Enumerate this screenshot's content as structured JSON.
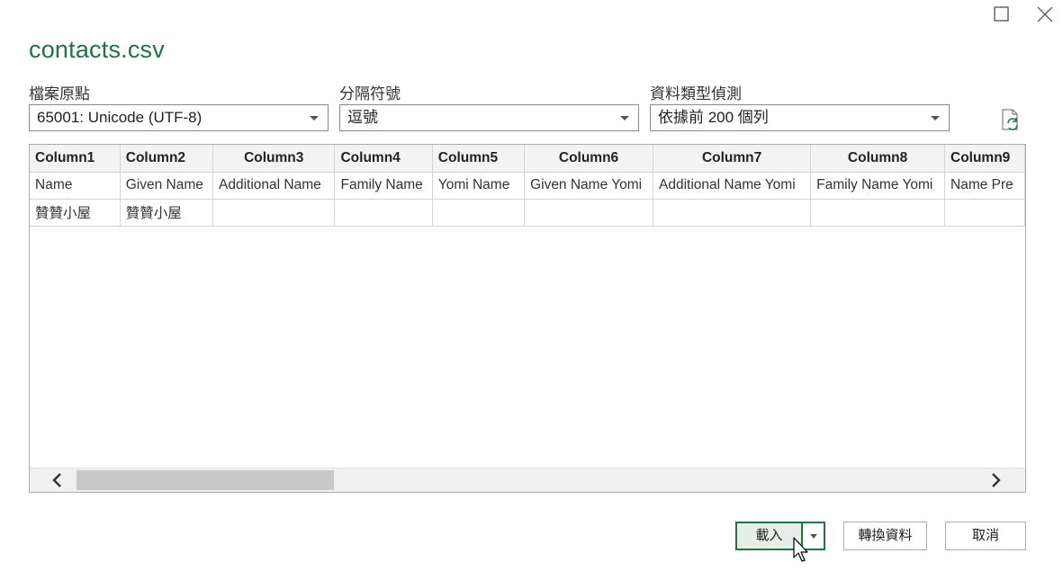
{
  "window": {
    "maximize_icon": "maximize-icon",
    "close_icon": "close-icon"
  },
  "title": "contacts.csv",
  "options": {
    "file_origin": {
      "label": "檔案原點",
      "value": "65001: Unicode (UTF-8)"
    },
    "delimiter": {
      "label": "分隔符號",
      "value": "逗號"
    },
    "type_detection": {
      "label": "資料類型偵測",
      "value": "依據前 200 個列"
    }
  },
  "preview": {
    "headers": [
      "Column1",
      "Column2",
      "Column3",
      "Column4",
      "Column5",
      "Column6",
      "Column7",
      "Column8",
      "Column9"
    ],
    "rows": [
      [
        "Name",
        "Given Name",
        "Additional Name",
        "Family Name",
        "Yomi Name",
        "Given Name Yomi",
        "Additional Name Yomi",
        "Family Name Yomi",
        "Name Pre"
      ],
      [
        "贊贊小屋",
        "贊贊小屋",
        "",
        "",
        "",
        "",
        "",
        "",
        ""
      ]
    ]
  },
  "scrollbar": {
    "position": 0.0
  },
  "buttons": {
    "load": "載入",
    "transform": "轉換資料",
    "cancel": "取消"
  },
  "colors": {
    "accent": "#217346"
  }
}
